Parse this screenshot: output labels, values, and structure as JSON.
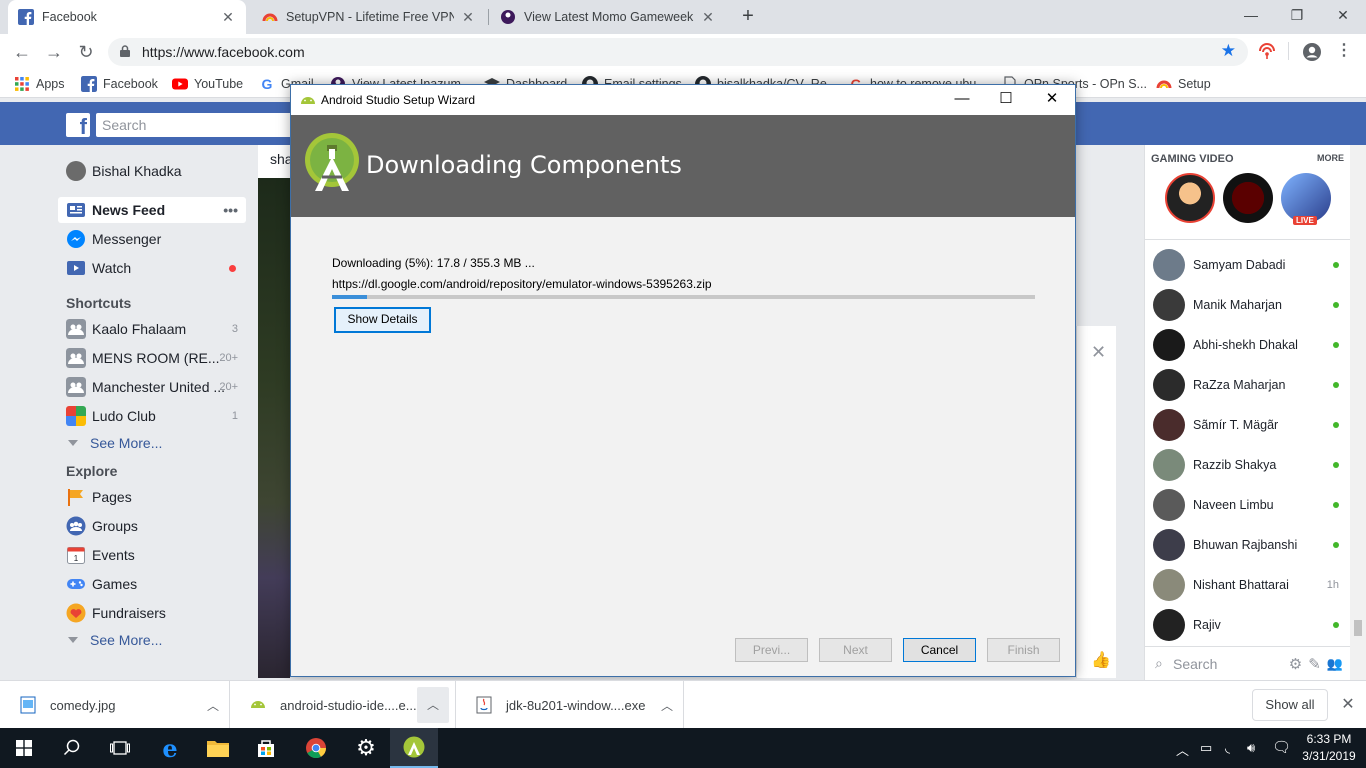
{
  "browser": {
    "tabs": [
      {
        "title": "Facebook",
        "active": true
      },
      {
        "title": "SetupVPN - Lifetime Free VPN - C",
        "active": false
      },
      {
        "title": "View Latest Momo Gameweek Po",
        "active": false
      }
    ],
    "url": "https://www.facebook.com",
    "bookmarks": [
      "Apps",
      "Facebook",
      "YouTube",
      "Gmail",
      "View Latest Inazum...",
      "Dashboard",
      "Email settings",
      "bisalkhadka/CV_Re...",
      "how to remove ubu...",
      "OPn Sports - OPn S...",
      "Setup"
    ]
  },
  "facebook": {
    "search_placeholder": "Search",
    "user_name": "Bishal Khadka",
    "nav": [
      {
        "label": "News Feed"
      },
      {
        "label": "Messenger"
      },
      {
        "label": "Watch"
      }
    ],
    "shortcuts_heading": "Shortcuts",
    "shortcuts": [
      {
        "label": "Kaalo Fhalaam",
        "count": "3"
      },
      {
        "label": "MENS ROOM (RE...",
        "count": "20+"
      },
      {
        "label": "Manchester United ...",
        "count": "20+"
      },
      {
        "label": "Ludo Club",
        "count": "1"
      }
    ],
    "see_more": "See More...",
    "explore_heading": "Explore",
    "explore": [
      {
        "label": "Pages"
      },
      {
        "label": "Groups"
      },
      {
        "label": "Events"
      },
      {
        "label": "Games"
      },
      {
        "label": "Fundraisers"
      }
    ],
    "feed_fragment": "sha",
    "gaming_heading": "GAMING VIDEO",
    "gaming_more": "MORE",
    "contacts": [
      {
        "name": "Samyam Dabadi",
        "status": "online"
      },
      {
        "name": "Manik Maharjan",
        "status": "online"
      },
      {
        "name": "Abhi-shekh Dhakal",
        "status": "online"
      },
      {
        "name": "RaZza Maharjan",
        "status": "online"
      },
      {
        "name": "Sãmír T. Mägãr",
        "status": "online"
      },
      {
        "name": "Razzib Shakya",
        "status": "online"
      },
      {
        "name": "Naveen Limbu",
        "status": "online"
      },
      {
        "name": "Bhuwan Rajbanshi",
        "status": "online"
      },
      {
        "name": "Nishant Bhattarai",
        "status": "1h"
      },
      {
        "name": "Rajiv",
        "status": "online"
      }
    ],
    "chat_search": "Search"
  },
  "dialog": {
    "window_title": "Android Studio Setup Wizard",
    "heading": "Downloading Components",
    "status": "Downloading (5%): 17.8 / 355.3 MB ...",
    "url": "https://dl.google.com/android/repository/emulator-windows-5395263.zip",
    "progress_fraction": 0.05,
    "show_details": "Show Details",
    "buttons": {
      "prev": "Previ...",
      "next": "Next",
      "cancel": "Cancel",
      "finish": "Finish"
    }
  },
  "downloads": {
    "items": [
      "comedy.jpg",
      "android-studio-ide....e...",
      "jdk-8u201-window....exe"
    ],
    "show_all": "Show all"
  },
  "taskbar": {
    "time": "6:33 PM",
    "date": "3/31/2019"
  },
  "colors": {
    "facebook_blue": "#4267b2",
    "dialog_header": "#616161",
    "progress_fill": "#3b8fd9",
    "android_green": "#a4c639"
  }
}
